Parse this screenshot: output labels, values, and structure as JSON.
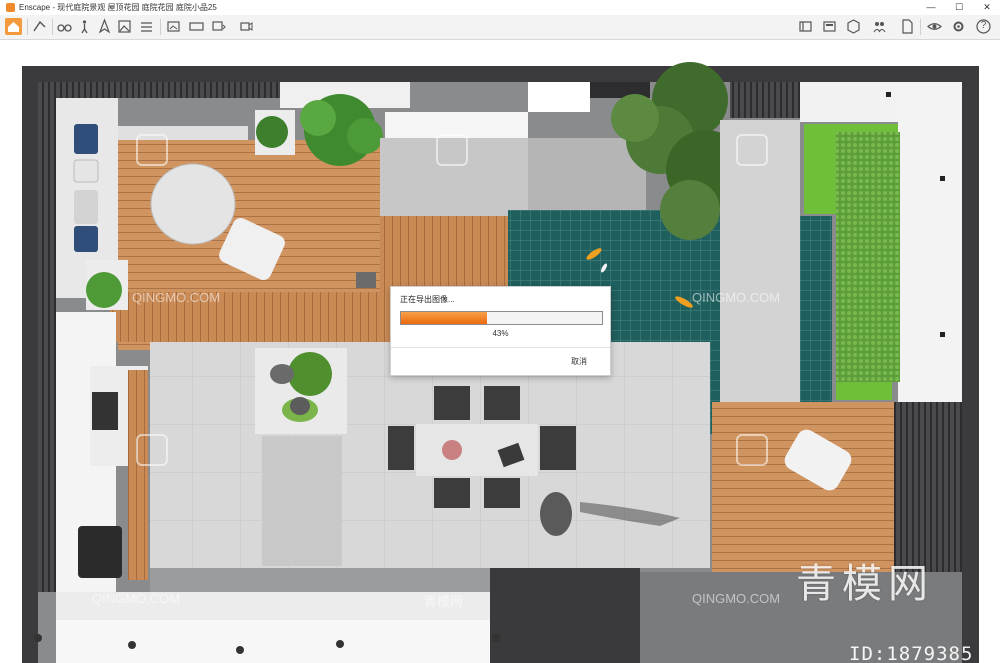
{
  "window": {
    "title": "Enscape - 现代庭院景观 屋顶花园 庭院花园 庭院小品25",
    "minimize_glyph": "—",
    "maximize_glyph": "☐",
    "close_glyph": "✕"
  },
  "toolbar": {
    "left_icons": [
      "home-icon",
      "capture-icon",
      "binoculars-icon",
      "walk-icon",
      "compass-icon",
      "mountain-icon",
      "grid-icon",
      "export-image-icon",
      "export-panorama-icon",
      "batch-export-icon",
      "video-export-icon"
    ],
    "right_icons": [
      "asset-library-icon",
      "materials-icon",
      "cube-icon",
      "people-icon",
      "file-icon",
      "eye-icon",
      "settings-icon",
      "help-icon"
    ],
    "help_label": "?"
  },
  "dialog": {
    "title": "正在导出图像...",
    "progress": 0.43,
    "percent_label": "43%",
    "cancel_label": "取消"
  },
  "watermarks": {
    "big_text": "青模网",
    "id_text": "ID:1879385",
    "small_text": "QINGMO.COM",
    "small_cn": "青模网"
  },
  "colors": {
    "accent": "#f29a3c",
    "progress_start": "#f7a14a",
    "progress_end": "#ec6a0c",
    "wood": "#c98a55",
    "pool": "#1f5f5e",
    "grass": "#6fbf3a",
    "wall_dark": "#3a3a3c",
    "paving": "#d9d9d9"
  }
}
